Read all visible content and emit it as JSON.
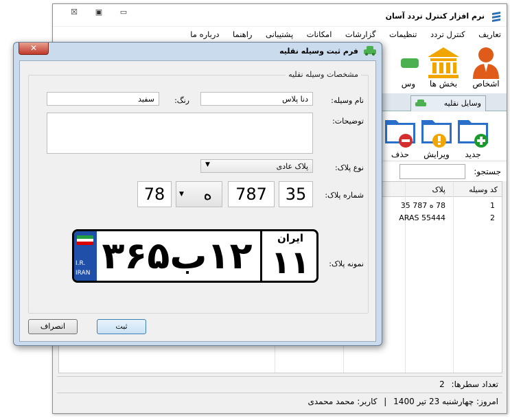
{
  "main_window": {
    "title": "نرم افزار کنترل تردد آسان",
    "controls": {
      "close": "☒",
      "maximize": "▣",
      "minimize": "▭"
    },
    "menu": [
      "تعاریف",
      "کنترل تردد",
      "تنظیمات",
      "گزارشات",
      "امکانات",
      "پشتیبانی",
      "راهنما",
      "درباره ما"
    ],
    "ribbon": [
      {
        "label": "اشخاص",
        "icon": "person-icon"
      },
      {
        "label": "بخش ها",
        "icon": "building-icon"
      },
      {
        "label": "وس",
        "icon": "vehicle-icon"
      }
    ],
    "tab": "وسایل نقلیه",
    "folder_buttons": [
      {
        "label": "جدید",
        "icon": "folder-add-icon"
      },
      {
        "label": "ویرایش",
        "icon": "folder-edit-icon"
      },
      {
        "label": "حذف",
        "icon": "folder-delete-icon"
      }
    ],
    "search_label": "جستجو:",
    "search_value": "",
    "grid": {
      "columns": [
        "کد وسیله",
        "پلاک"
      ],
      "rows": [
        {
          "code": "1",
          "plate": "78 ه 787 35"
        },
        {
          "code": "2",
          "plate": "ARAS 55444"
        }
      ]
    },
    "row_count_label": "تعداد سطرها:",
    "row_count": "2",
    "status": {
      "date_label": "امروز: چهارشنبه 23 تیر 1400",
      "separator": "|",
      "user_label": "کاربر: محمد محمدی"
    }
  },
  "dialog": {
    "title": "فرم ثبت وسیله نقلیه",
    "close": "✕",
    "group_title": "مشخصات وسیله نقلیه",
    "name_label": "نام وسیله:",
    "name_value": "دنا پلاس",
    "color_label": "رنگ:",
    "color_value": "سفید",
    "desc_label": "توضیحات:",
    "desc_value": "",
    "plate_type_label": "نوع پلاک:",
    "plate_type_value": "پلاک عادی",
    "plate_number_label": "شماره پلاک:",
    "plate_parts": {
      "p1": "35",
      "p2": "787",
      "letter": "ه",
      "p4": "78"
    },
    "sample_label": "نمونه پلاک:",
    "sample_plate": {
      "main": "۱۲ب۳۶۵",
      "region_label": "ایران",
      "region": "۱۱",
      "ir": "I.R.",
      "iran": "IRAN"
    },
    "submit": "ثبت",
    "cancel": "انصراف"
  }
}
